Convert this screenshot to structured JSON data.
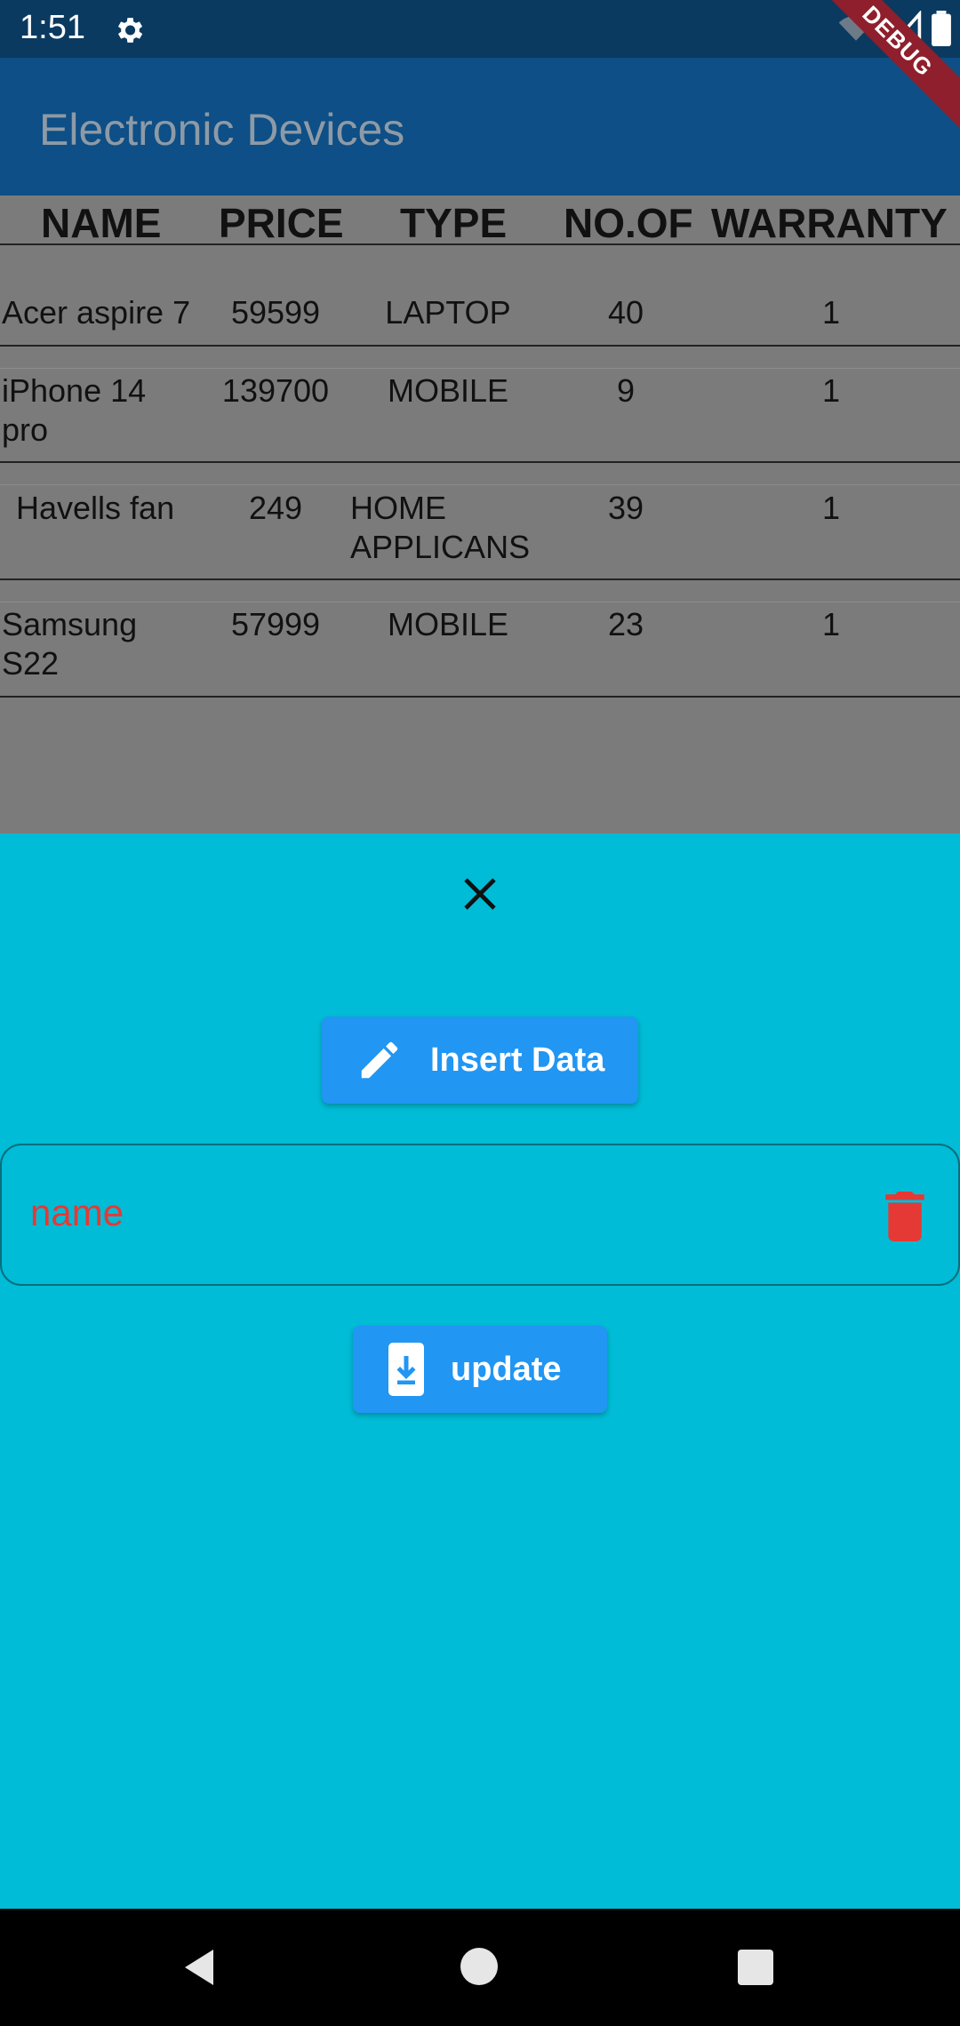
{
  "status_bar": {
    "time": "1:51"
  },
  "debug_banner": "DEBUG",
  "app_bar": {
    "title": "Electronic Devices"
  },
  "table": {
    "headers": [
      "NAME",
      "PRICE",
      "TYPE",
      "NO.OF",
      "WARRANTY"
    ],
    "rows": [
      {
        "name": "Acer aspire 7",
        "price": "59599",
        "type": "LAPTOP",
        "count": "40",
        "warranty": "1"
      },
      {
        "name": "iPhone 14 pro",
        "price": "139700",
        "type": "MOBILE",
        "count": "9",
        "warranty": "1"
      },
      {
        "name": "Havells fan",
        "price": "249",
        "type": "HOME APPLICANS",
        "count": "39",
        "warranty": "1"
      },
      {
        "name": "Samsung S22",
        "price": "57999",
        "type": "MOBILE",
        "count": "23",
        "warranty": "1"
      }
    ]
  },
  "sheet": {
    "insert_button": "Insert Data",
    "name_field_label": "name",
    "update_button": "update"
  },
  "colors": {
    "app_bar": "#0d4f86",
    "sheet": "#00bcd6",
    "button": "#2196f3",
    "field_label": "#e53935"
  }
}
